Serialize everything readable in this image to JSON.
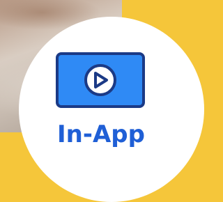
{
  "badge": {
    "label": "In-App",
    "icon": "video-play-icon",
    "label_color": "#1f5fd6",
    "icon_fill": "#2f8af5",
    "icon_stroke": "#1b3a86"
  },
  "background": {
    "accent_color": "#f5c63a",
    "badge_color": "#ffffff"
  }
}
